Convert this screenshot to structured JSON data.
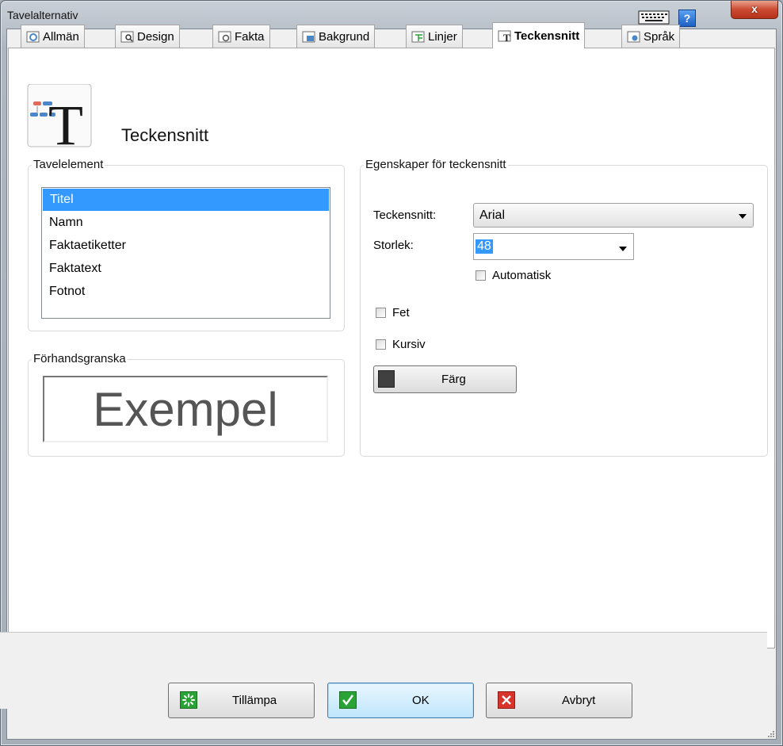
{
  "window": {
    "title": "Tavelalternativ",
    "help_label": "?",
    "close_label": "x"
  },
  "tabs": [
    {
      "label": "Allmän",
      "icon": "settings-icon"
    },
    {
      "label": "Design",
      "icon": "design-icon"
    },
    {
      "label": "Fakta",
      "icon": "facts-icon"
    },
    {
      "label": "Bakgrund",
      "icon": "background-icon"
    },
    {
      "label": "Linjer",
      "icon": "lines-icon"
    },
    {
      "label": "Teckensnitt",
      "icon": "font-icon",
      "active": true
    },
    {
      "label": "Språk",
      "icon": "language-icon"
    }
  ],
  "header": {
    "title": "Teckensnitt"
  },
  "tavelelement": {
    "group_label": "Tavelelement",
    "items": [
      "Titel",
      "Namn",
      "Faktaetiketter",
      "Faktatext",
      "Fotnot"
    ],
    "selected": "Titel"
  },
  "preview": {
    "group_label": "Förhandsgranska",
    "sample": "Exempel"
  },
  "font_props": {
    "group_label": "Egenskaper för teckensnitt",
    "font_label": "Teckensnitt:",
    "font_value": "Arial",
    "size_label": "Storlek:",
    "size_value": "48",
    "automatic_label": "Automatisk",
    "bold_label": "Fet",
    "italic_label": "Kursiv",
    "color_label": "Färg",
    "color_value": "#404040"
  },
  "buttons": {
    "apply": "Tillämpa",
    "ok": "OK",
    "cancel": "Avbryt"
  },
  "colors": {
    "selection": "#3399ff",
    "apply_icon": "#2aa336",
    "ok_icon": "#2aa336",
    "cancel_icon": "#d9342b"
  }
}
